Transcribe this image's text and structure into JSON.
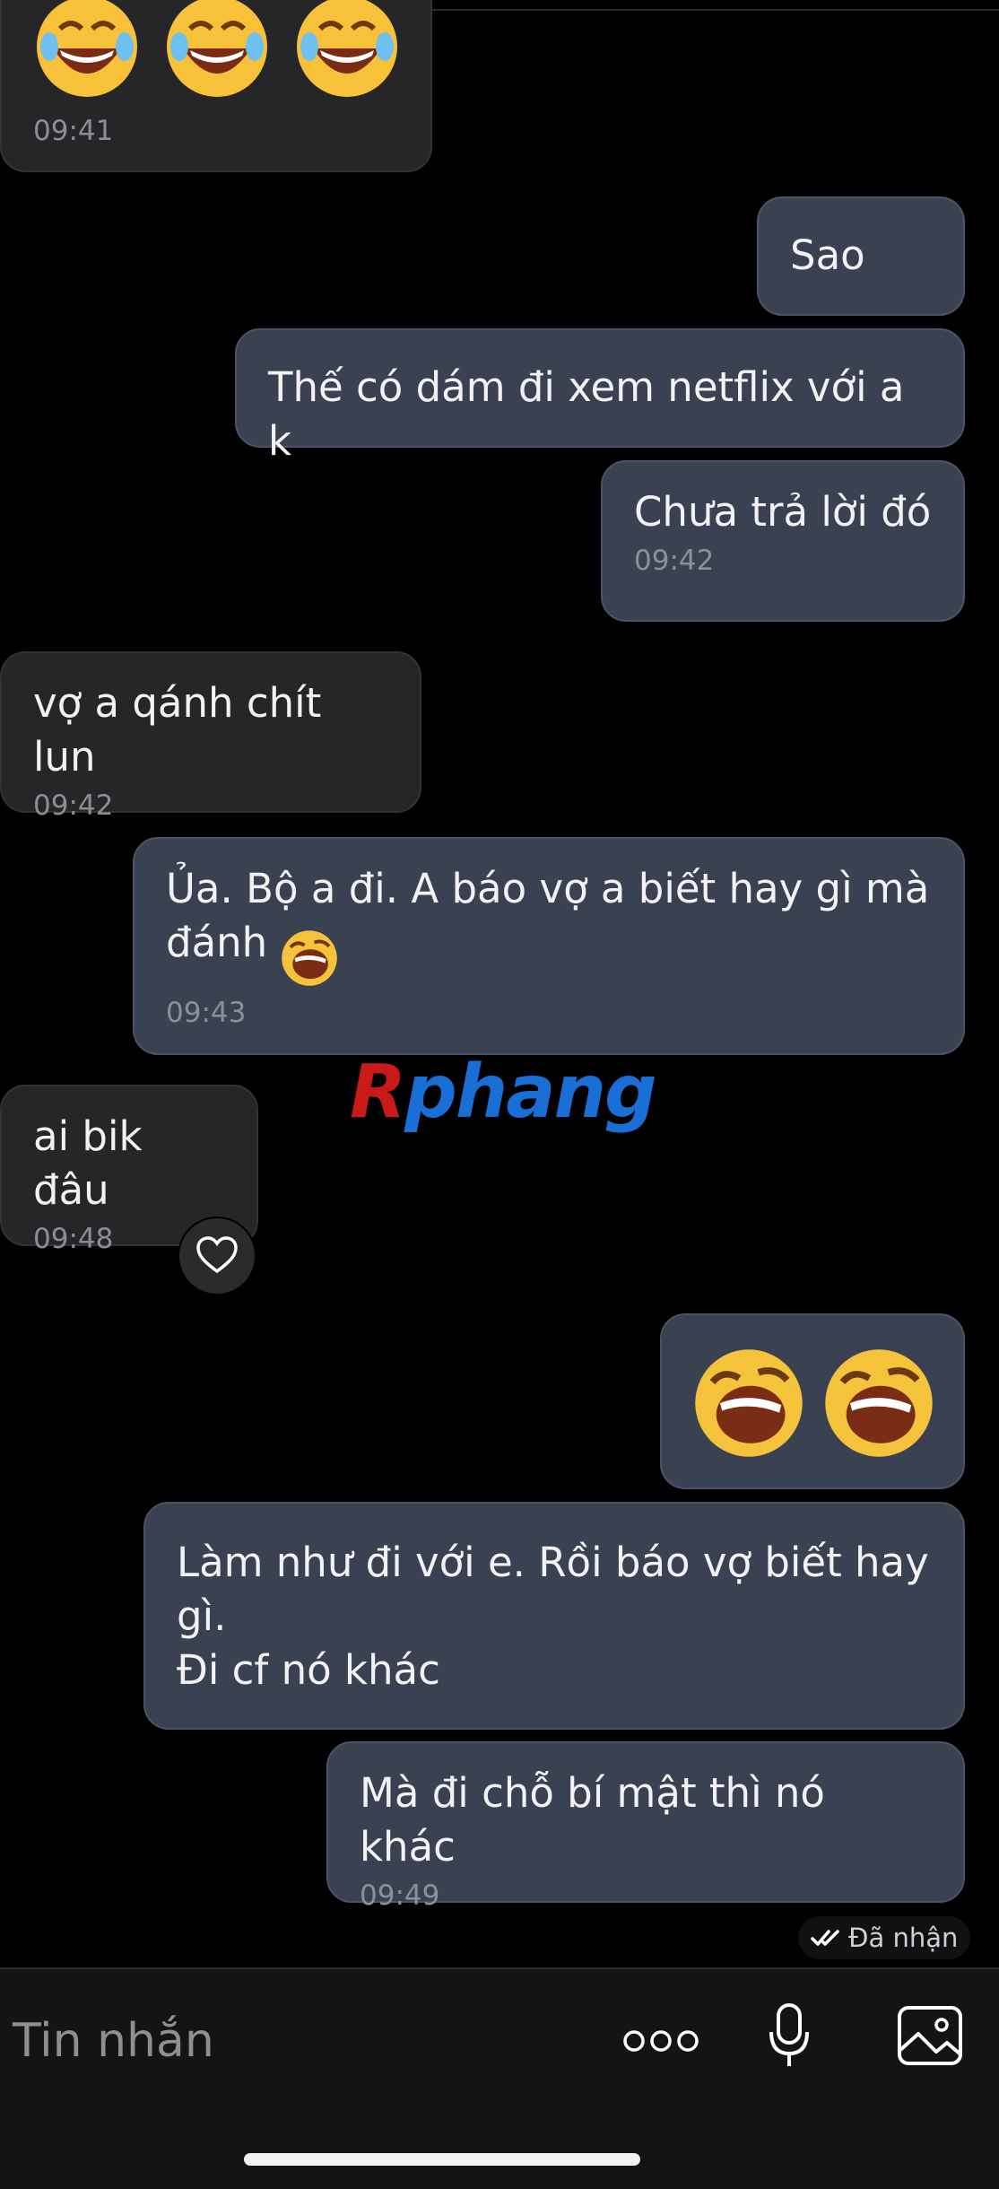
{
  "messages": [
    {
      "side": "in",
      "text": "",
      "time": "09:41",
      "emoji": "joy-emoji x3"
    },
    {
      "side": "out",
      "text": "Sao",
      "time": ""
    },
    {
      "side": "out",
      "text": "Thế có dám đi xem netflix với a k",
      "time": ""
    },
    {
      "side": "out",
      "text": "Chưa trả lời đó",
      "time": "09:42"
    },
    {
      "side": "in",
      "text": "vợ a qánh chít lun",
      "time": "09:42"
    },
    {
      "side": "out",
      "text": "Ủa. Bộ a đi. A báo vợ a biết hay gì mà\nđánh",
      "time": "09:43",
      "emoji": "laughing-emoji"
    },
    {
      "side": "in",
      "text": "ai bik đâu",
      "time": "09:48"
    },
    {
      "side": "out",
      "text": "",
      "time": "",
      "emoji": "laughing-emoji x2"
    },
    {
      "side": "out",
      "text": "Làm như đi với e. Rồi báo vợ biết hay\ngì.\nĐi cf nó khác",
      "time": ""
    },
    {
      "side": "out",
      "text": "Mà đi chỗ bí mật thì nó khác",
      "time": "09:49"
    }
  ],
  "receipt": {
    "label": "Đã nhận"
  },
  "input": {
    "placeholder": "Tin nhắn"
  },
  "watermark": {
    "first": "R",
    "rest": "phang"
  },
  "icons": [
    "heart-icon",
    "more-icon",
    "microphone-icon",
    "image-icon",
    "double-check-icon"
  ],
  "colors": {
    "background": "#000000",
    "incoming": "#262628",
    "outgoing": "#3a4150"
  }
}
